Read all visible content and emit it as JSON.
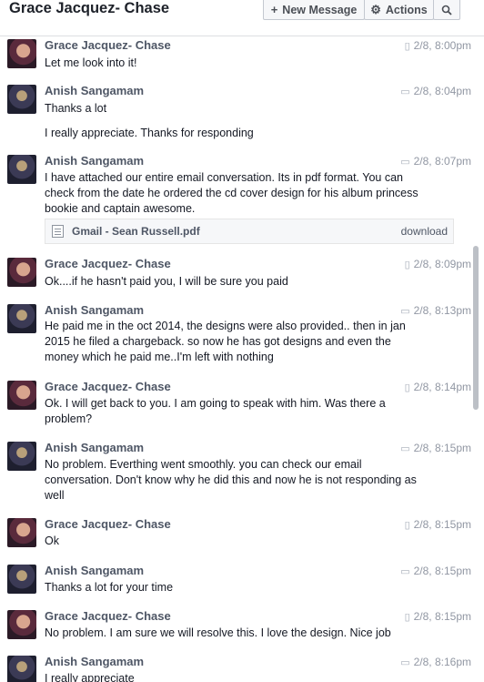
{
  "header": {
    "title": "Grace Jacquez- Chase",
    "new_message_label": "New Message",
    "new_message_icon": "plus-icon",
    "actions_label": "Actions",
    "actions_icon": "gear-icon",
    "search_icon": "search-icon"
  },
  "messages": [
    {
      "sender": "Grace Jacquez- Chase",
      "time": "2/8, 8:00pm",
      "device": "mobile",
      "lines": [
        "Let me look into it!"
      ]
    },
    {
      "sender": "Anish Sangamam",
      "time": "2/8, 8:04pm",
      "device": "web",
      "lines": [
        "Thanks a lot",
        "I really appreciate. Thanks for responding"
      ]
    },
    {
      "sender": "Anish Sangamam",
      "time": "2/8, 8:07pm",
      "device": "web",
      "lines": [
        "I have attached our entire email conversation. Its in pdf format.  You can check from the date he ordered the cd cover design for his album princess bookie and captain awesome."
      ],
      "attachment": {
        "name": "Gmail - Sean Russell.pdf",
        "action": "download"
      }
    },
    {
      "sender": "Grace Jacquez- Chase",
      "time": "2/8, 8:09pm",
      "device": "mobile",
      "lines": [
        "Ok....if he hasn't paid you, I will be sure you paid"
      ]
    },
    {
      "sender": "Anish Sangamam",
      "time": "2/8, 8:13pm",
      "device": "web",
      "lines": [
        "He paid me in the oct 2014, the designs were also provided.. then in jan 2015 he filed a chargeback. so now he has got designs and even the money which he paid me..I'm left with nothing"
      ]
    },
    {
      "sender": "Grace Jacquez- Chase",
      "time": "2/8, 8:14pm",
      "device": "mobile",
      "lines": [
        "Ok. I will get back to you. I am going to speak with him. Was there a problem?"
      ]
    },
    {
      "sender": "Anish Sangamam",
      "time": "2/8, 8:15pm",
      "device": "web",
      "lines": [
        "No problem. Everthing went smoothly. you can check our email conversation. Don't know why he did this and now he is not responding as well"
      ]
    },
    {
      "sender": "Grace Jacquez- Chase",
      "time": "2/8, 8:15pm",
      "device": "mobile",
      "lines": [
        "Ok"
      ]
    },
    {
      "sender": "Anish Sangamam",
      "time": "2/8, 8:15pm",
      "device": "web",
      "lines": [
        "Thanks a lot for your time"
      ]
    },
    {
      "sender": "Grace Jacquez- Chase",
      "time": "2/8, 8:15pm",
      "device": "mobile",
      "lines": [
        "No problem. I am sure we will resolve this. I love the design. Nice job"
      ]
    },
    {
      "sender": "Anish Sangamam",
      "time": "2/8, 8:16pm",
      "device": "web",
      "lines": [
        "I really appreciate"
      ]
    }
  ]
}
